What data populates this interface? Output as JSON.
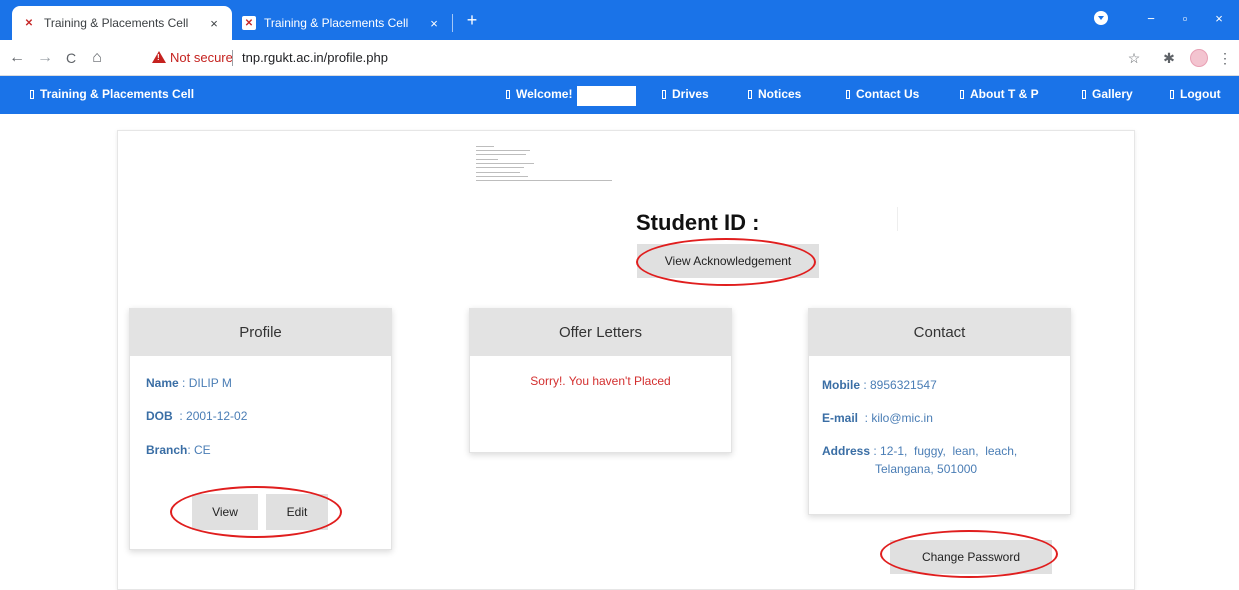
{
  "browser": {
    "tabs": [
      {
        "title": "Training & Placements Cell",
        "close": "×"
      },
      {
        "title": "Training & Placements Cell",
        "close": "×"
      }
    ],
    "new_tab": "+",
    "window_controls": {
      "minimize": "−",
      "maximize": "▫",
      "close": "×"
    },
    "nav": {
      "back": "←",
      "forward": "→",
      "reload": "C",
      "home": "⌂"
    },
    "security_label": "Not secure",
    "url": "tnp.rgukt.ac.in/profile.php",
    "toolbar_icons": {
      "star": "☆",
      "extensions": "✱",
      "menu": "⋮"
    }
  },
  "navbar": {
    "brand": "Training & Placements Cell",
    "items": [
      {
        "label": "Welcome!"
      },
      {
        "label": "Drives"
      },
      {
        "label": "Notices"
      },
      {
        "label": "Contact Us"
      },
      {
        "label": "About T & P"
      },
      {
        "label": "Gallery"
      },
      {
        "label": "Logout"
      }
    ]
  },
  "header": {
    "student_id_label": "Student ID :",
    "ack_button": "View Acknowledgement"
  },
  "profile_card": {
    "title": "Profile",
    "fields": [
      {
        "label": "Name",
        "sep": " : ",
        "value": "DILIP M"
      },
      {
        "label": "DOB",
        "sep": "  : ",
        "value": "2001-12-02"
      },
      {
        "label": "Branch",
        "sep": ": ",
        "value": "CE"
      }
    ],
    "view_button": "View",
    "edit_button": "Edit"
  },
  "offer_card": {
    "title": "Offer Letters",
    "message": "Sorry!. You haven't Placed"
  },
  "contact_card": {
    "title": "Contact",
    "mobile_label": "Mobile",
    "mobile_value": " : 8956321547",
    "email_label": "E-mail",
    "email_value": "  : kilo@mic.in",
    "address_label": "Address",
    "address_line1": " : 12-1,  fuggy,  lean,  leach,",
    "address_line2": "Telangana, 501000",
    "change_password_button": "Change Password"
  },
  "colors": {
    "chrome_blue": "#1a73e8",
    "annotation_red": "#e01e1e",
    "label_blue": "#3a6ea5",
    "error_red": "#d32f2f"
  }
}
